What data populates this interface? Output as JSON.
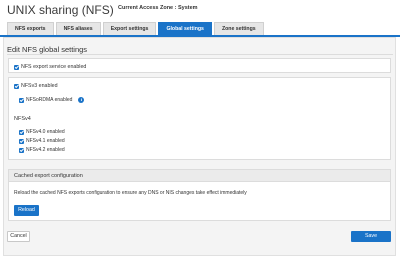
{
  "header": {
    "title": "UNIX sharing (NFS)",
    "zone_label": "Current Access Zone : System"
  },
  "tabs": [
    {
      "label": "NFS exports",
      "active": false
    },
    {
      "label": "NFS aliases",
      "active": false
    },
    {
      "label": "Export settings",
      "active": false
    },
    {
      "label": "Global settings",
      "active": true
    },
    {
      "label": "Zone settings",
      "active": false
    }
  ],
  "page": {
    "section_title": "Edit NFS global settings"
  },
  "export_service": {
    "label": "NFS export service enabled",
    "checked": true
  },
  "nfsv3": {
    "label": "NFSv3 enabled",
    "checked": true,
    "rdma": {
      "label": "NFSoRDMA enabled",
      "checked": true,
      "info_icon": "info-icon"
    }
  },
  "nfsv4": {
    "heading": "NFSv4",
    "options": [
      {
        "label": "NFSv4.0 enabled",
        "checked": true
      },
      {
        "label": "NFSv4.1 enabled",
        "checked": true
      },
      {
        "label": "NFSv4.2 enabled",
        "checked": true
      }
    ]
  },
  "cache": {
    "heading": "Cached export configuration",
    "description": "Reload the cached NFS exports configuration to ensure any DNS or NIS changes take effect immediately",
    "reload_label": "Reload"
  },
  "footer": {
    "cancel_label": "Cancel",
    "save_label": "Save"
  },
  "colors": {
    "accent": "#1a73c8",
    "panel_bg": "#f4f4f4"
  }
}
